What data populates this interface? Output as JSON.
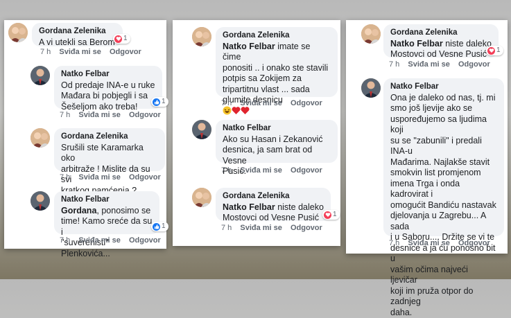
{
  "actions": {
    "time": "7 h",
    "like": "Sviđa mi se",
    "reply": "Odgovor"
  },
  "panel1": {
    "c1": {
      "author": "Gordana Zelenika",
      "text": "A vi utekli sa Berom",
      "reactions": "1",
      "reaction_icon": "heart-icon"
    },
    "c2": {
      "author": "Natko Felbar",
      "text": "Od predaje INA-e u ruke\nMađara bi pobjegli i sa\nŠešeljom ako treba!",
      "reactions": "1",
      "reaction_icon": "like-icon"
    },
    "c3": {
      "author": "Gordana Zelenika",
      "text": "Srušili ste Karamarka oko\narbitraže ! Mislite da su svi\nkratkog pamćenja ?"
    },
    "c4": {
      "author": "Natko Felbar",
      "tag": "Gordana",
      "text": ", ponosimo se\ntime! Kamo sreće da su i\n\"suverenisti\" Plenkovića...",
      "reactions": "1",
      "reaction_icon": "like-icon"
    }
  },
  "panel2": {
    "c1": {
      "author": "Gordana Zelenika",
      "tag": "Natko Felbar",
      "text": " imate se čime\nponositi .. i onako ste stavili\npotpis sa Zokijem za\ntripartitnu vlast ... sada\nglumite desnicu",
      "emoji": [
        "laughing-emoji",
        "heart-emoji",
        "heart-emoji"
      ]
    },
    "c2": {
      "author": "Natko Felbar",
      "text": "Ako su Hasan i Zekanović\ndesnica, ja sam brat od Vesne\nPusić."
    },
    "c3": {
      "author": "Gordana Zelenika",
      "tag": "Natko Felbar",
      "text": " niste daleko\nMostovci od Vesne Pusić",
      "reactions": "1",
      "reaction_icon": "heart-icon"
    }
  },
  "panel3": {
    "c1": {
      "author": "Gordana Zelenika",
      "tag": "Natko Felbar",
      "text": " niste daleko\nMostovci od Vesne Pusić",
      "reactions": "1",
      "reaction_icon": "heart-icon"
    },
    "c2": {
      "author": "Natko Felbar",
      "text": "Ona je daleko od nas, tj. mi\nsmo još ljevije ako se\nuspoređujemo sa ljudima koji\nsu se \"zabunili\" i predali INA-u\nMađarima. Najlakše stavit\nsmokvin list promjenom\nimena Trga i onda kadrovirat i\nomogućit Bandiću nastavak\ndjelovanja u Zagrebu... A sada\ni u Saboru.... Držite se vi te\ndesnice a ja ću ponosno bit u\nvašim očima najveći ljevičar\nkoji im pruža otpor do zadnjeg\ndaha."
    }
  },
  "colors": {
    "bubble": "#f0f2f5",
    "meta": "#606770",
    "like": "#1877f2",
    "heart": "#f33e58"
  }
}
